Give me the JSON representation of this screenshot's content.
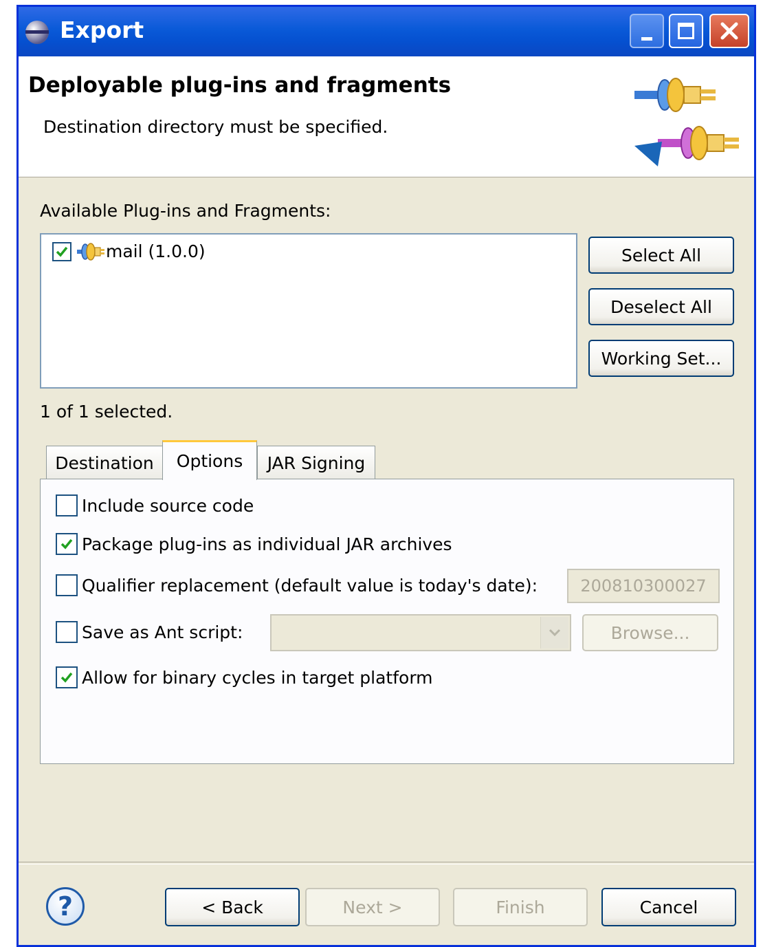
{
  "window": {
    "title": "Export"
  },
  "header": {
    "title": "Deployable plug-ins and fragments",
    "message": "Destination directory must be specified."
  },
  "available": {
    "label": "Available Plug-ins and Fragments:",
    "items": [
      {
        "label": "mail (1.0.0)",
        "checked": true
      }
    ],
    "status": "1 of 1 selected."
  },
  "side_buttons": {
    "select_all": "Select All",
    "deselect_all": "Deselect All",
    "working_set": "Working Set..."
  },
  "tabs": [
    {
      "label": "Destination",
      "active": false
    },
    {
      "label": "Options",
      "active": true
    },
    {
      "label": "JAR Signing",
      "active": false
    }
  ],
  "options": {
    "include_source": {
      "label": "Include source code",
      "checked": false
    },
    "package_jars": {
      "label": "Package plug-ins as individual JAR archives",
      "checked": true
    },
    "qualifier": {
      "label": "Qualifier replacement (default value is today's date):",
      "checked": false,
      "value": "200810300027"
    },
    "ant_script": {
      "label": "Save as Ant script:",
      "checked": false,
      "value": "",
      "browse": "Browse..."
    },
    "binary_cycles": {
      "label": "Allow for binary cycles in target platform",
      "checked": true
    }
  },
  "footer": {
    "help": "?",
    "back": "< Back",
    "next": "Next >",
    "finish": "Finish",
    "cancel": "Cancel"
  },
  "colors": {
    "title_bar": "#0a5ad8",
    "dialog_bg": "#ece9d8",
    "check_green": "#21a121",
    "tab_highlight": "#ffc83c"
  }
}
